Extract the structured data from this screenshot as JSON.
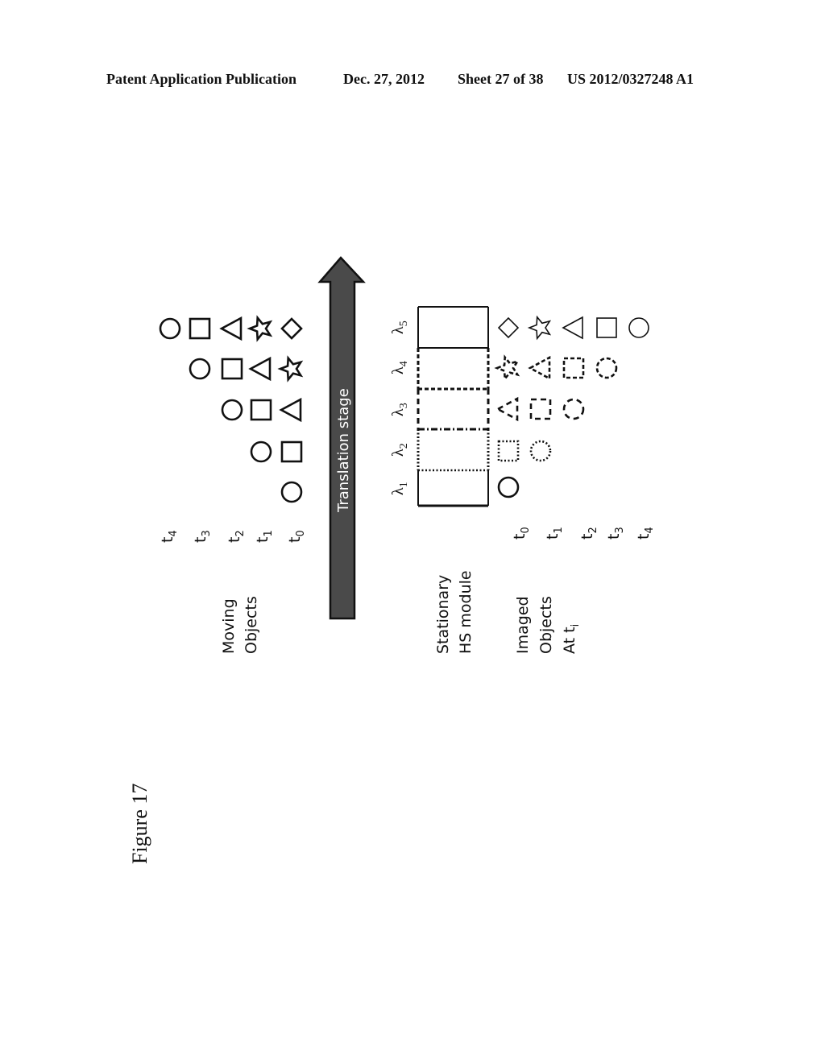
{
  "header": {
    "publication": "Patent Application Publication",
    "date": "Dec. 27, 2012",
    "sheet": "Sheet 27 of 38",
    "number": "US 2012/0327248 A1"
  },
  "figure": {
    "label": "Figure 17",
    "arrow_label": "Translation stage",
    "moving_objects": {
      "title_line1": "Moving",
      "title_line2": "Objects",
      "time_labels": [
        {
          "base": "t",
          "sub": "4"
        },
        {
          "base": "t",
          "sub": "3"
        },
        {
          "base": "t",
          "sub": "2"
        },
        {
          "base": "t",
          "sub": "1"
        },
        {
          "base": "t",
          "sub": "0"
        }
      ],
      "rows": [
        {
          "time": "t4",
          "shapes": [
            "circle",
            "square",
            "triangle",
            "star",
            "diamond"
          ]
        },
        {
          "time": "t3",
          "shapes": [
            "circle",
            "square",
            "triangle",
            "star"
          ]
        },
        {
          "time": "t2",
          "shapes": [
            "circle",
            "square",
            "triangle"
          ]
        },
        {
          "time": "t1",
          "shapes": [
            "circle",
            "square"
          ]
        },
        {
          "time": "t0",
          "shapes": [
            "circle"
          ]
        }
      ]
    },
    "hs_module": {
      "title_line1": "Stationary",
      "title_line2": "HS module",
      "bands": [
        {
          "base": "λ",
          "sub": "5",
          "style": "solid"
        },
        {
          "base": "λ",
          "sub": "4",
          "style": "dashed"
        },
        {
          "base": "λ",
          "sub": "3",
          "style": "long-dashed"
        },
        {
          "base": "λ",
          "sub": "2",
          "style": "dotted"
        },
        {
          "base": "λ",
          "sub": "1",
          "style": "solid"
        }
      ]
    },
    "imaged_objects": {
      "title_line1": "Imaged",
      "title_line2": "Objects",
      "title_line3": "At t",
      "title_line3_sub": "i",
      "time_labels": [
        {
          "base": "t",
          "sub": "0"
        },
        {
          "base": "t",
          "sub": "1"
        },
        {
          "base": "t",
          "sub": "2"
        },
        {
          "base": "t",
          "sub": "3"
        },
        {
          "base": "t",
          "sub": "4"
        }
      ],
      "rows": [
        {
          "band": "λ5",
          "style": "solid",
          "shapes": [
            "diamond",
            "star",
            "triangle",
            "square",
            "circle"
          ]
        },
        {
          "band": "λ4",
          "style": "dashed",
          "shapes": [
            "star",
            "triangle",
            "square",
            "circle"
          ]
        },
        {
          "band": "λ3",
          "style": "long-dashed",
          "shapes": [
            "triangle",
            "square",
            "circle"
          ]
        },
        {
          "band": "λ2",
          "style": "dotted",
          "shapes": [
            "square",
            "circle"
          ]
        },
        {
          "band": "λ1",
          "style": "solid",
          "shapes": [
            "circle"
          ]
        }
      ]
    }
  }
}
